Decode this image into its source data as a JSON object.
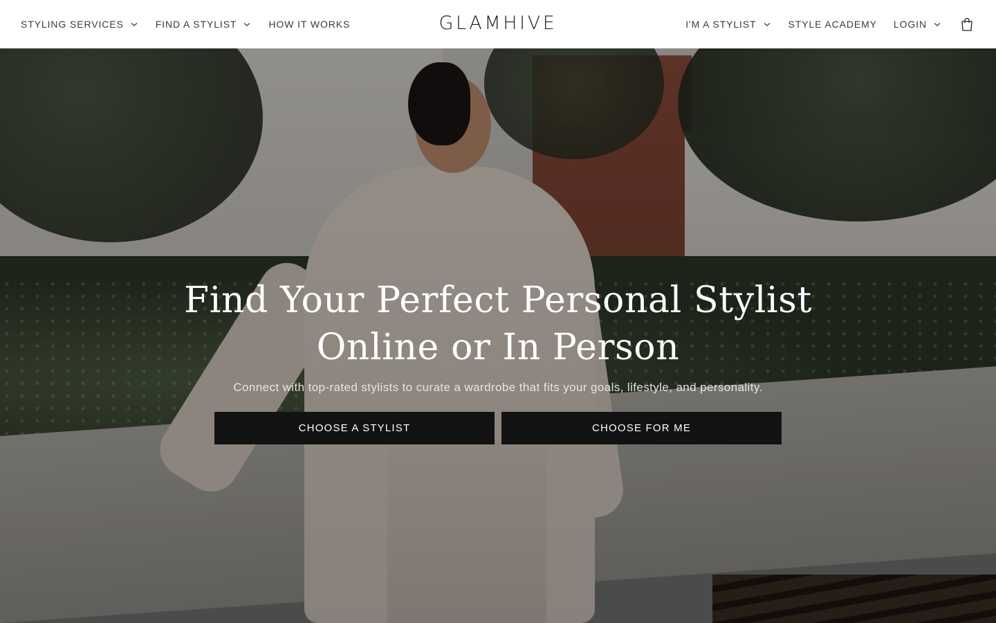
{
  "header": {
    "logo": "GLAMHIVE",
    "nav_left": [
      {
        "label": "STYLING SERVICES",
        "has_dropdown": true
      },
      {
        "label": "FIND A STYLIST",
        "has_dropdown": true
      },
      {
        "label": "HOW IT WORKS",
        "has_dropdown": false
      }
    ],
    "nav_right": [
      {
        "label": "I'M A STYLIST",
        "has_dropdown": true
      },
      {
        "label": "STYLE ACADEMY",
        "has_dropdown": false
      },
      {
        "label": "LOGIN",
        "has_dropdown": true
      }
    ],
    "cart_icon": "shopping-bag-icon"
  },
  "hero": {
    "title_line1": "Find Your Perfect Personal Stylist",
    "title_line2": "Online or In Person",
    "subtitle": "Connect with top-rated stylists to curate a wardrobe that fits your goals, lifestyle, and personality.",
    "cta_primary": "CHOOSE A STYLIST",
    "cta_secondary": "CHOOSE FOR ME",
    "background_image": "woman-in-beige-suit-city-street-photo"
  },
  "colors": {
    "header_bg": "#ffffff",
    "nav_text": "#3a3a3a",
    "button_bg": "#121212",
    "button_text": "#ffffff",
    "hero_title": "#ffffff"
  }
}
